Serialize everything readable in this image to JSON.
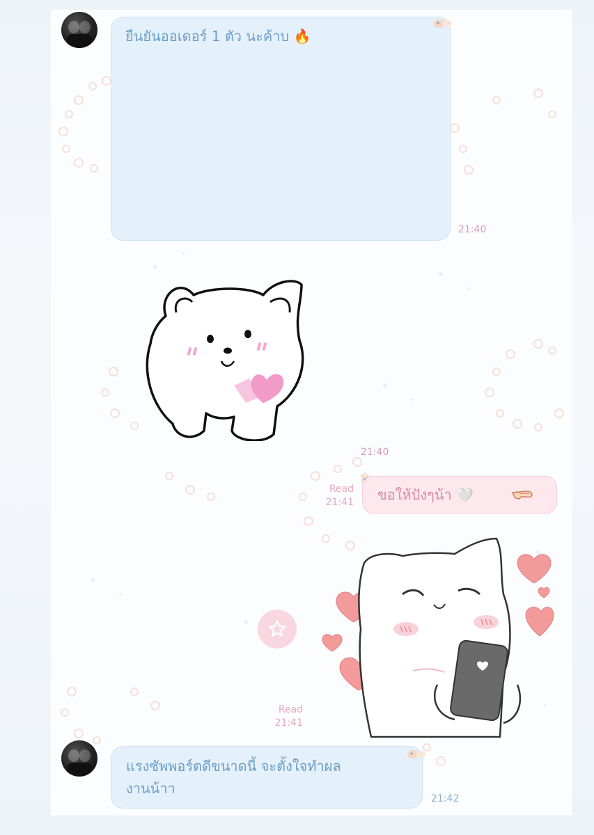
{
  "messages": [
    {
      "id": "m1",
      "sender": "other",
      "text": "ยืนยันออเดอร์ 1 ตัว นะค้าบ 🔥",
      "time": "21:40"
    },
    {
      "id": "m2",
      "sender": "other",
      "type": "sticker",
      "sticker": "white-puppy-heart-sticker",
      "time": "21:40"
    },
    {
      "id": "m3",
      "sender": "me",
      "text": "ขอให้ปังๆน้า 🤍",
      "status": "Read",
      "time": "21:41"
    },
    {
      "id": "m4",
      "sender": "me",
      "type": "sticker",
      "sticker": "white-cat-phone-hearts-sticker",
      "status": "Read",
      "time": "21:41"
    },
    {
      "id": "m5",
      "sender": "other",
      "text_line1": "แรงซัพพอร์ตดีขนาดนี้ จะตั้งใจทำผล",
      "text_line2": "งานน้าา",
      "time": "21:42"
    }
  ],
  "colors": {
    "incoming_bubble": "#e4f1fb",
    "outgoing_bubble": "#fde8ee",
    "incoming_text": "#6d9ec6",
    "outgoing_text": "#d98aa4",
    "time_pink": "#d79cb1"
  },
  "icons": [
    "avatar",
    "fire-emoji",
    "heart-emoji",
    "hand-emoji",
    "star-icon"
  ]
}
